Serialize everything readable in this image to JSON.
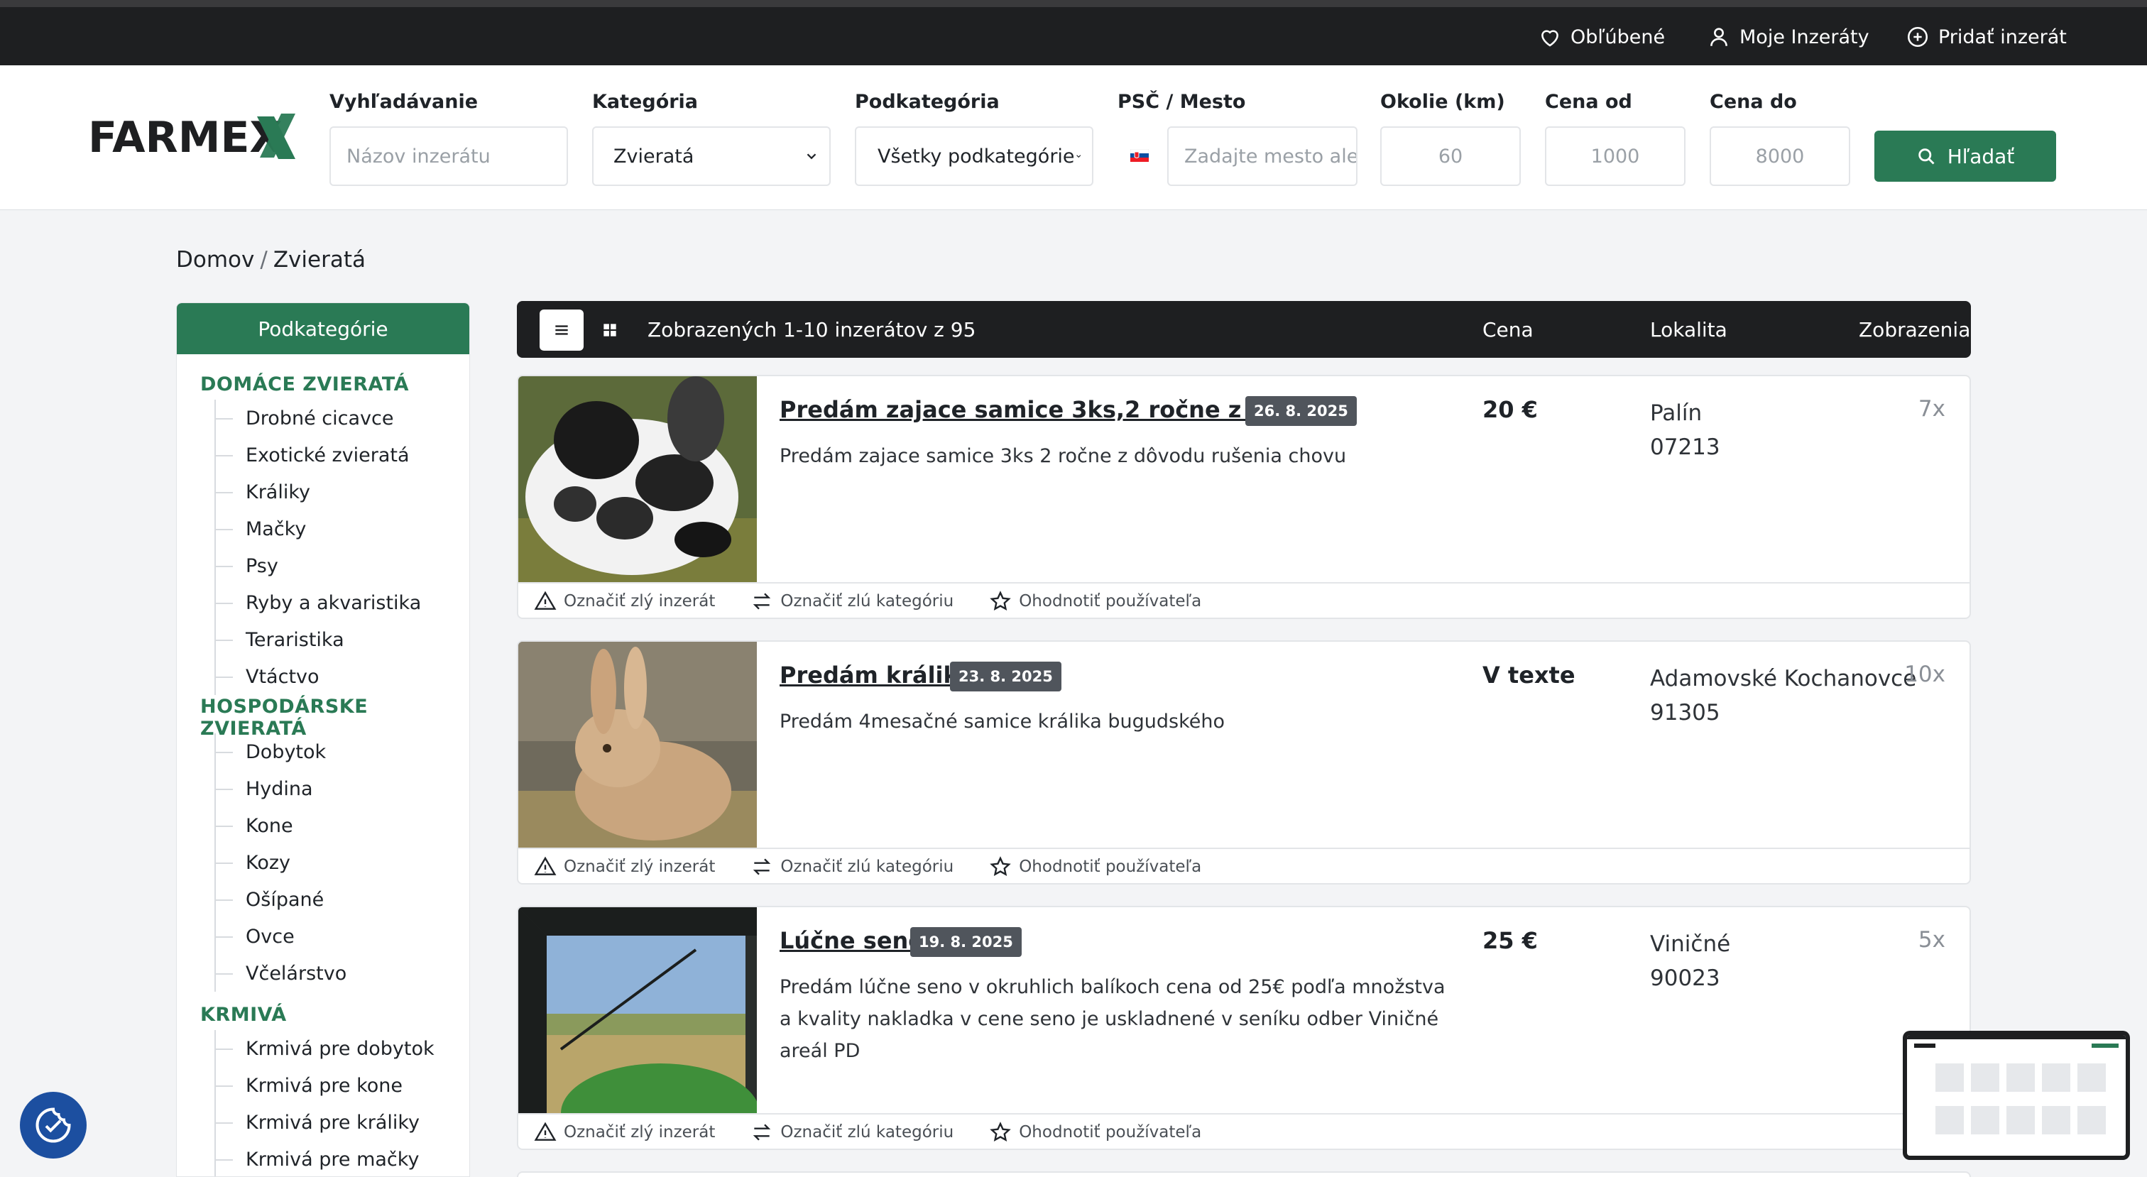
{
  "topbar": {
    "favorites": "Obľúbené",
    "my_listings": "Moje Inzeráty",
    "add_listing": "Pridať inzerát"
  },
  "logo": "FARMEX",
  "search": {
    "query_label": "Vyhľadávanie",
    "query_placeholder": "Názov inzerátu",
    "category_label": "Kategória",
    "category_value": "Zvieratá",
    "subcategory_label": "Podkategória",
    "subcategory_value": "Všetky podkategórie",
    "location_label": "PSČ / Mesto",
    "location_placeholder": "Zadajte mesto ale",
    "radius_label": "Okolie (km)",
    "radius_placeholder": "60",
    "price_from_label": "Cena od",
    "price_from_placeholder": "1000",
    "price_to_label": "Cena do",
    "price_to_placeholder": "8000",
    "button": "Hľadať"
  },
  "breadcrumb": {
    "home": "Domov",
    "sep": "/",
    "current": "Zvieratá"
  },
  "sidebar": {
    "title": "Podkategórie",
    "groups": [
      {
        "title": "DOMÁCE ZVIERATÁ",
        "items": [
          "Drobné cicavce",
          "Exotické zvieratá",
          "Králiky",
          "Mačky",
          "Psy",
          "Ryby a akvaristika",
          "Teraristika",
          "Vtáctvo"
        ]
      },
      {
        "title": "HOSPODÁRSKE ZVIERATÁ",
        "items": [
          "Dobytok",
          "Hydina",
          "Kone",
          "Kozy",
          "Ošípané",
          "Ovce",
          "Včelárstvo"
        ]
      },
      {
        "title": "KRMIVÁ",
        "items": [
          "Krmivá pre dobytok",
          "Krmivá pre kone",
          "Krmivá pre králiky",
          "Krmivá pre mačky"
        ]
      }
    ]
  },
  "listbar": {
    "count_text": "Zobrazených 1-10 inzerátov z 95",
    "col_price": "Cena",
    "col_location": "Lokalita",
    "col_views": "Zobrazenia"
  },
  "actions": {
    "report": "Označiť zlý inzerát",
    "wrong_category": "Označiť zlú kategóriu",
    "rate_user": "Ohodnotiť používateľa"
  },
  "listings": [
    {
      "title": "Predám zajace samice 3ks,2 ročne z dôv...",
      "date": "26. 8. 2025",
      "desc": "Predám zajace samice 3ks 2 ročne z dôvodu rušenia chovu",
      "price": "20 €",
      "city": "Palín",
      "zip": "07213",
      "views": "7x"
    },
    {
      "title": "Predám králiky",
      "date": "23. 8. 2025",
      "desc": "Predám 4mesačné samice králika bugudského",
      "price": "V texte",
      "city": "Adamovské Kochanovce",
      "zip": "91305",
      "views": "10x"
    },
    {
      "title": "Lúčne seno",
      "date": "19. 8. 2025",
      "desc": "Predám lúčne seno v okruhlich balíkoch cena od 25€ podľa množstva a kvality nakladka v cene seno je uskladnené v seníku odber Viničné areál PD",
      "price": "25 €",
      "city": "Viničné",
      "zip": "90023",
      "views": "5x"
    }
  ],
  "colors": {
    "brand_green": "#2a7a55",
    "dark": "#1e1f21",
    "cookie_blue": "#1c4fa0"
  }
}
